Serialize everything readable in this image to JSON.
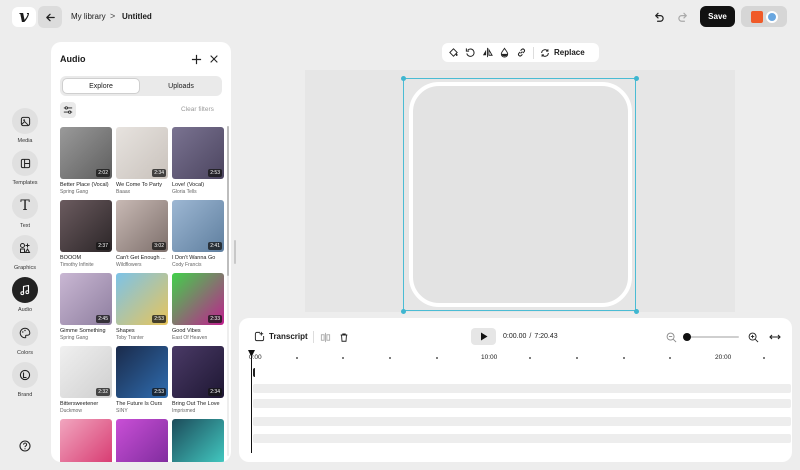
{
  "header": {
    "logo_text": "v",
    "breadcrumb_parent": "My library",
    "breadcrumb_separator": ">",
    "breadcrumb_current": "Untitled",
    "save_label": "Save"
  },
  "sidebar": {
    "items": [
      {
        "label": "Media",
        "icon": "image-icon",
        "active": false
      },
      {
        "label": "Templates",
        "icon": "templates-icon",
        "active": false
      },
      {
        "label": "Text",
        "icon": "text-icon",
        "active": false
      },
      {
        "label": "Graphics",
        "icon": "graphics-icon",
        "active": false
      },
      {
        "label": "Audio",
        "icon": "music-note-icon",
        "active": true
      },
      {
        "label": "Colors",
        "icon": "palette-icon",
        "active": false
      },
      {
        "label": "Brand",
        "icon": "brand-icon",
        "active": false
      }
    ],
    "help_icon": "help-icon"
  },
  "audio_panel": {
    "title": "Audio",
    "tabs": [
      "Explore",
      "Uploads"
    ],
    "selected_tab": "Explore",
    "clear_filters": "Clear filters",
    "tracks": [
      {
        "title": "Better Place (Vocal)",
        "artist": "Spring Gang",
        "duration": "2:02",
        "colors": [
          "#9a9a9a",
          "#5e5e5e"
        ]
      },
      {
        "title": "We Come To Party",
        "artist": "Baaax",
        "duration": "2:34",
        "colors": [
          "#e7e3df",
          "#c9c2bc"
        ]
      },
      {
        "title": "Love! (Vocal)",
        "artist": "Gloria Tells",
        "duration": "2:53",
        "colors": [
          "#7a7391",
          "#4c4560"
        ]
      },
      {
        "title": "BOOOM",
        "artist": "Timothy Infinite",
        "duration": "2:37",
        "colors": [
          "#6b5b5f",
          "#2c2628"
        ]
      },
      {
        "title": "Can't Get Enough ...",
        "artist": "Wildflowers",
        "duration": "3:02",
        "colors": [
          "#c8b9b4",
          "#7e706c"
        ]
      },
      {
        "title": "I Don't Wanna Go",
        "artist": "Cody Francis",
        "duration": "2:41",
        "colors": [
          "#9db7d3",
          "#5f7f9f"
        ]
      },
      {
        "title": "Gimme Something",
        "artist": "Spring Gang",
        "duration": "2:45",
        "colors": [
          "#c9b7d3",
          "#8f7fa0"
        ]
      },
      {
        "title": "Shapes",
        "artist": "Toby Tranter",
        "duration": "2:53",
        "colors": [
          "#7cc3e8",
          "#e8c45a"
        ]
      },
      {
        "title": "Good Vibes",
        "artist": "East Of Heaven",
        "duration": "2:33",
        "colors": [
          "#41d14a",
          "#c0208f"
        ]
      },
      {
        "title": "Bittersweetener",
        "artist": "Duckmow",
        "duration": "2:32",
        "colors": [
          "#f0f0f0",
          "#cfcfcf"
        ]
      },
      {
        "title": "The Future Is Ours",
        "artist": "SINY",
        "duration": "2:53",
        "colors": [
          "#1a2a4a",
          "#2f6db0"
        ]
      },
      {
        "title": "Bring Out The Love",
        "artist": "Imprismed",
        "duration": "2:34",
        "colors": [
          "#4a3a66",
          "#1e1733"
        ]
      },
      {
        "title": "",
        "artist": "",
        "duration": "",
        "colors": [
          "#f1a6bf",
          "#d6336c"
        ]
      },
      {
        "title": "",
        "artist": "",
        "duration": "",
        "colors": [
          "#c94fd6",
          "#7a2a9a"
        ]
      },
      {
        "title": "",
        "artist": "",
        "duration": "",
        "colors": [
          "#1c4b5a",
          "#45d3c9"
        ]
      }
    ]
  },
  "canvas_toolbar": {
    "icons": [
      "paint-bucket-icon",
      "rotate-icon",
      "flip-icon",
      "opacity-icon",
      "link-icon"
    ],
    "replace_label": "Replace"
  },
  "timeline": {
    "transcript_label": "Transcript",
    "time_current": "0:00.00",
    "time_separator": "/",
    "time_total": "7:20.43",
    "ruler_labels": [
      "0:00",
      "10:00",
      "20:00"
    ],
    "zoom_level": 0.0
  },
  "colors": {
    "accent_cyan": "#3fb6d0",
    "save_bg": "#111111"
  }
}
